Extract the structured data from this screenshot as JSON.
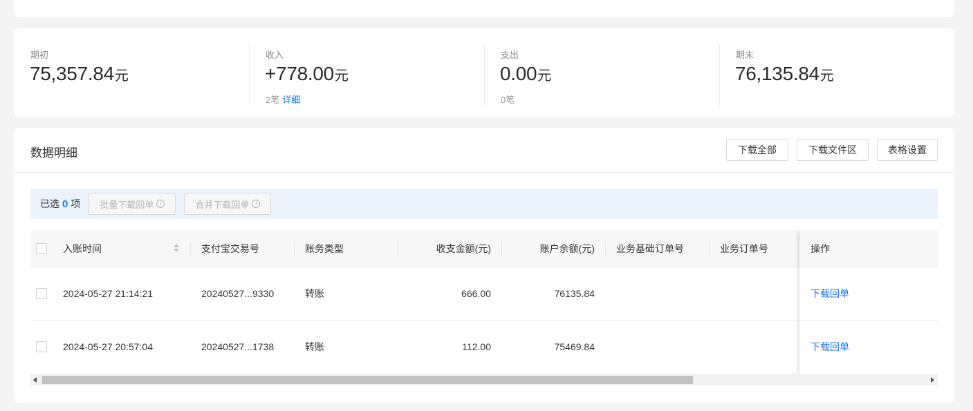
{
  "summary": {
    "opening": {
      "label": "期初",
      "value": "75,357.84",
      "unit": "元"
    },
    "income": {
      "label": "收入",
      "value": "+778.00",
      "unit": "元",
      "count": "2笔",
      "detail_link": "详细"
    },
    "expense": {
      "label": "支出",
      "value": "0.00",
      "unit": "元",
      "count": "0笔"
    },
    "closing": {
      "label": "期末",
      "value": "76,135.84",
      "unit": "元"
    }
  },
  "detail": {
    "title": "数据明细",
    "buttons": {
      "download_all": "下载全部",
      "download_area": "下载文件区",
      "table_settings": "表格设置"
    },
    "selection": {
      "prefix": "已选",
      "count": "0",
      "suffix": "项",
      "batch_download": "批量下载回单",
      "merge_download": "合并下载回单"
    },
    "columns": [
      "入账时间",
      "支付宝交易号",
      "账务类型",
      "收支金额(元)",
      "账户余额(元)",
      "业务基础订单号",
      "业务订单号",
      "操作"
    ],
    "rows": [
      {
        "time": "2024-05-27 21:14:21",
        "trade_no": "20240527...9330",
        "type": "转账",
        "amount": "666.00",
        "balance": "76135.84",
        "base_order": "",
        "order": "",
        "action": "下载回单"
      },
      {
        "time": "2024-05-27 20:57:04",
        "trade_no": "20240527...1738",
        "type": "转账",
        "amount": "112.00",
        "balance": "75469.84",
        "base_order": "",
        "order": "",
        "action": "下载回单"
      }
    ]
  },
  "colors": {
    "accent": "#1677ff",
    "selection_bar": "#ebf3fe",
    "page_bg": "#f4f4f4"
  }
}
